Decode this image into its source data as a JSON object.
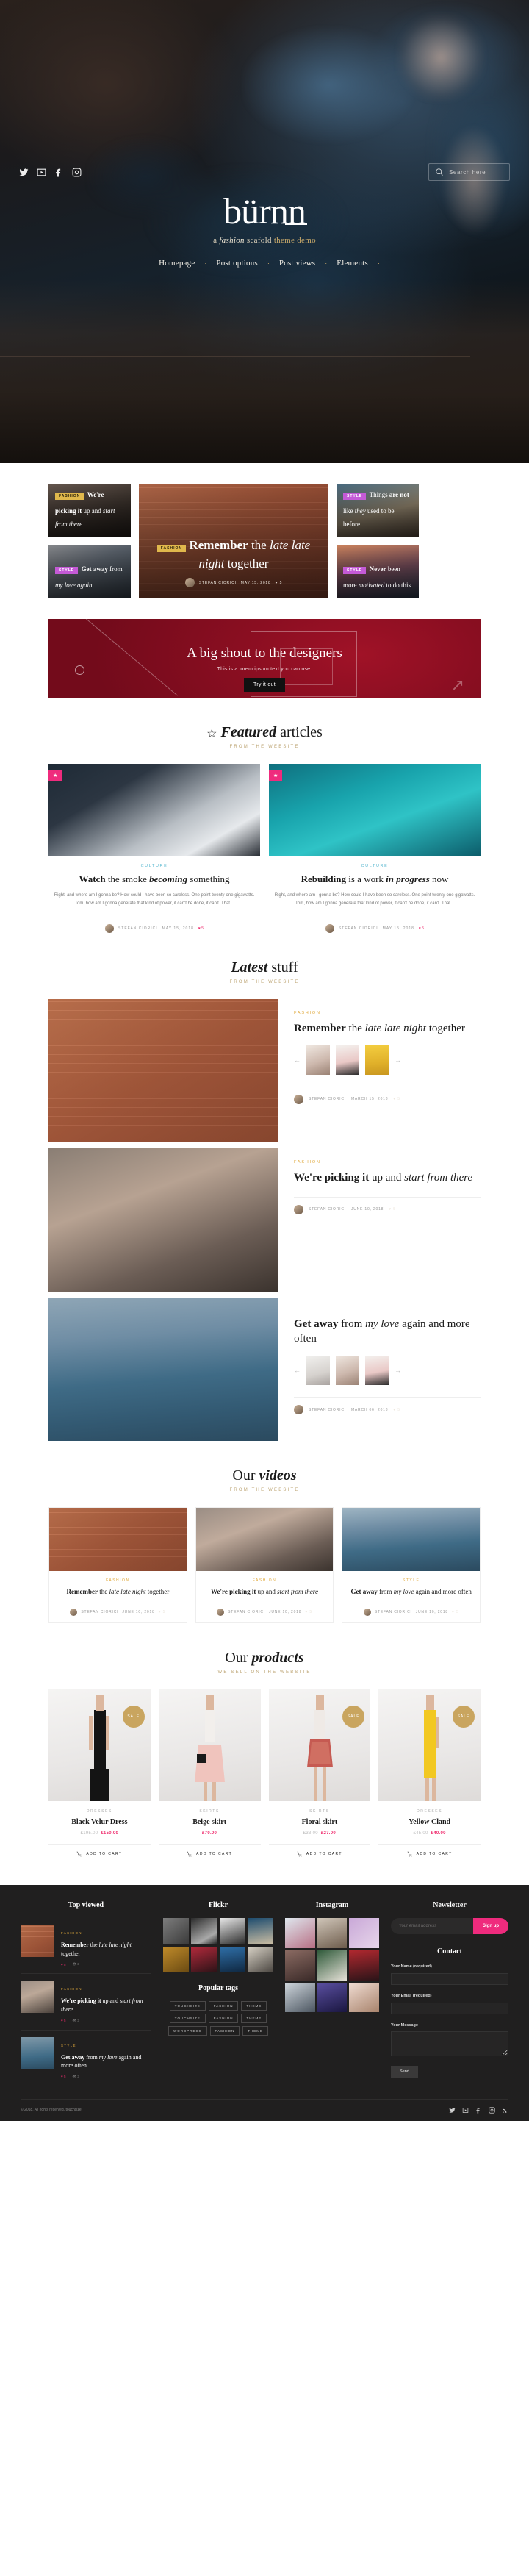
{
  "header": {
    "brand": "bürnn",
    "tagline_parts": {
      "a": "a ",
      "fashion": "fashion",
      "mid": " scafold ",
      "theme": "theme demo"
    },
    "nav": [
      {
        "label": "Homepage"
      },
      {
        "label": "Post options"
      },
      {
        "label": "Post views"
      },
      {
        "label": "Elements"
      }
    ],
    "social": [
      {
        "name": "twitter-icon",
        "label": "Twitter"
      },
      {
        "name": "vimeo-icon",
        "label": "Vimeo"
      },
      {
        "name": "facebook-icon",
        "label": "Facebook"
      },
      {
        "name": "instagram-icon",
        "label": "Instagram"
      }
    ],
    "search": {
      "placeholder": "Search here",
      "value": ""
    }
  },
  "feature_grid": {
    "left": [
      {
        "badge": "FASHION",
        "badge_type": "fashion",
        "title_bold": "We're picking it",
        "title_rest": " up and ",
        "title_italic": "start from there"
      },
      {
        "badge": "STYLE",
        "badge_type": "style",
        "title_bold": "Get away",
        "title_rest": " from ",
        "title_italic": "my love again"
      }
    ],
    "center": {
      "badge": "FASHION",
      "badge_type": "fashion",
      "title_bold": "Remember",
      "title_rest": " the ",
      "title_italic": "late late night",
      "title_tail": " together",
      "author": "STEFAN CIORICI",
      "date": "MAY 15, 2018",
      "likes": "5"
    },
    "right": [
      {
        "badge": "STYLE",
        "badge_type": "style",
        "title_lead": "Things ",
        "title_bold": "are not",
        "title_rest": " like ",
        "title_italic": "they",
        "title_tail": " used to be before"
      },
      {
        "badge": "STYLE",
        "badge_type": "style",
        "title_lead": "",
        "title_bold": "Never",
        "title_rest": " been more ",
        "title_italic": "motivated",
        "title_tail": " to do this"
      }
    ]
  },
  "banner": {
    "heading": "A big shout to the designers",
    "subtext": "This is a lorem ipsum text you can use.",
    "button": "Try it out"
  },
  "featured": {
    "icon": "star-icon",
    "title_italic": "Featured",
    "title_rest": " articles",
    "subtitle": "from the website",
    "cards": [
      {
        "badge_icon": "star-icon",
        "category": "CULTURE",
        "category_color": "blue",
        "title_bold": "Watch",
        "title_rest": " the smoke ",
        "title_italic": "becoming",
        "title_tail": " something",
        "excerpt": "Right, and where am I gonna be? How could I have been so careless. One point twenty-one gigawatts. Tom, how am I gonna generate that kind of power, it can't be done, it can't. That...",
        "author": "STEFAN CIORICI",
        "date": "MAY 15, 2018",
        "likes": "5"
      },
      {
        "badge_icon": "star-icon",
        "category": "CULTURE",
        "category_color": "blue",
        "title_bold": "Rebuilding",
        "title_rest": " is a work ",
        "title_italic": "in progress",
        "title_tail": " now",
        "excerpt": "Right, and where am I gonna be? How could I have been so careless. One point twenty-one gigawatts. Tom, how am I gonna generate that kind of power, it can't be done, it can't. That...",
        "author": "STEFAN CIORICI",
        "date": "MAY 15, 2018",
        "likes": "5"
      }
    ]
  },
  "latest": {
    "title_italic": "Latest",
    "title_rest": " stuff",
    "subtitle": "from the website",
    "posts": [
      {
        "category": "FASHION",
        "title_bold": "Remember",
        "title_rest": " the ",
        "title_italic": "late late night",
        "title_tail": " together",
        "author": "STEFAN CIORICI",
        "date": "MARCH 15, 2018",
        "likes": "5",
        "prev": "←",
        "next": "→"
      },
      {
        "category": "FASHION",
        "title_bold": "We're picking it",
        "title_rest": " up and ",
        "title_italic": "start from there",
        "title_tail": "",
        "author": "STEFAN CIORICI",
        "date": "JUNE 10, 2018",
        "likes": "5",
        "prev": "←",
        "next": "→"
      },
      {
        "category": "STYLE",
        "title_bold": "Get away",
        "title_rest": " from ",
        "title_italic": "my love",
        "title_tail": " again and more often",
        "author": "STEFAN CIORICI",
        "date": "MARCH 06, 2018",
        "likes": "5",
        "prev": "←",
        "next": "→"
      }
    ]
  },
  "videos": {
    "title_rest": "Our ",
    "title_italic": "videos",
    "subtitle": "from the website",
    "cards": [
      {
        "category": "FASHION",
        "title_bold": "Remember",
        "title_rest": " the ",
        "title_italic": "late late night",
        "title_tail": " together",
        "author": "STEFAN CIORICI",
        "date": "JUNE 10, 2018",
        "likes": "5"
      },
      {
        "category": "FASHION",
        "title_bold": "We're picking it",
        "title_rest": " up and ",
        "title_italic": "start from there",
        "title_tail": "",
        "author": "STEFAN CIORICI",
        "date": "JUNE 10, 2018",
        "likes": "5"
      },
      {
        "category": "STYLE",
        "title_bold": "Get away",
        "title_rest": " from ",
        "title_italic": "my love",
        "title_tail": " again and more often",
        "author": "STEFAN CIORICI",
        "date": "JUNE 10, 2018",
        "likes": "5"
      }
    ]
  },
  "products": {
    "title_rest": "Our ",
    "title_italic": "products",
    "subtitle": "we sell on the website",
    "add_to_cart": "ADD TO CART",
    "sale_label": "SALE",
    "items": [
      {
        "category": "DRESSES",
        "name": "Black Velur Dress",
        "old_price": "£195.00",
        "price": "£150.00",
        "on_sale": true
      },
      {
        "category": "SKIRTS",
        "name": "Beige skirt",
        "old_price": "",
        "price": "£70.00",
        "on_sale": false
      },
      {
        "category": "SKIRTS",
        "name": "Floral skirt",
        "old_price": "£33.00",
        "price": "£27.00",
        "on_sale": true
      },
      {
        "category": "DRESSES",
        "name": "Yellow Cland",
        "old_price": "£45.00",
        "price": "£40.00",
        "on_sale": true
      }
    ]
  },
  "footer": {
    "top_viewed": {
      "title": "Top viewed",
      "items": [
        {
          "category": "FASHION",
          "title_bold": "Remember",
          "title_rest": " the ",
          "title_italic": "late late night",
          "title_tail": " together",
          "likes": "5",
          "views": "3"
        },
        {
          "category": "FASHION",
          "title_bold": "We're picking it",
          "title_rest": " up and ",
          "title_italic": "start from there",
          "title_tail": "",
          "likes": "5",
          "views": "3"
        },
        {
          "category": "STYLE",
          "title_bold": "Get away",
          "title_rest": " from ",
          "title_italic": "my love",
          "title_tail": " again and more often",
          "likes": "5",
          "views": "3"
        }
      ]
    },
    "flickr": {
      "title": "Flickr",
      "count": 8
    },
    "popular_tags": {
      "title": "Popular tags",
      "tags": [
        "TOUCHSIZE",
        "FASHION",
        "THEME",
        "TOUCHSIZE",
        "FASHION",
        "THEME",
        "WORDPRESS",
        "FASHION",
        "THEME"
      ]
    },
    "instagram": {
      "title": "Instagram",
      "count": 9
    },
    "newsletter": {
      "title": "Newsletter",
      "placeholder": "Your email address",
      "value": "",
      "button": "Sign up"
    },
    "contact": {
      "title": "Contact",
      "name_label": "Your Name (required)",
      "email_label": "Your Email (required)",
      "message_label": "Your Message",
      "send_label": "Send",
      "name_value": "",
      "email_value": "",
      "message_value": ""
    },
    "copyright": "© 2018. All rights reserved. touchsize",
    "social": [
      {
        "name": "twitter-icon"
      },
      {
        "name": "vimeo-icon"
      },
      {
        "name": "facebook-icon"
      },
      {
        "name": "instagram-icon"
      },
      {
        "name": "rss-icon"
      }
    ]
  }
}
